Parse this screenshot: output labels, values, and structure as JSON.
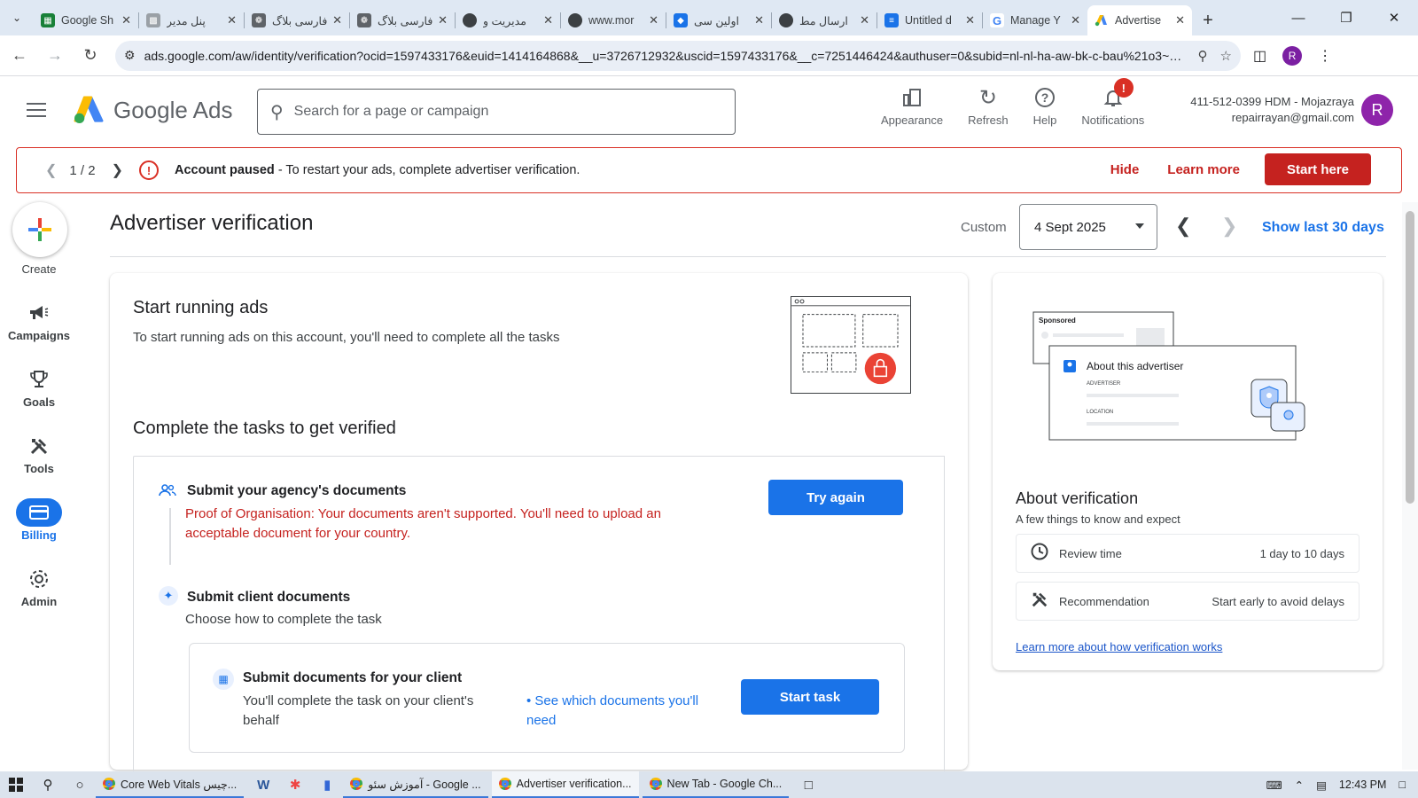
{
  "browser": {
    "tabs": [
      {
        "title": "Google Sh",
        "fav_color": "#188038",
        "fav_icon": "sheets-icon"
      },
      {
        "title": "پنل مدیر",
        "fav_color": "#9aa0a6",
        "fav_icon": "panel-icon"
      },
      {
        "title": "فارسی بلاگ",
        "fav_color": "#5f6368",
        "fav_icon": "gear-icon"
      },
      {
        "title": "فارسی بلاگ",
        "fav_color": "#5f6368",
        "fav_icon": "gear-icon"
      },
      {
        "title": "مدیریت و",
        "fav_color": "#3c4043",
        "fav_icon": "globe-icon"
      },
      {
        "title": "www.mor",
        "fav_color": "#3c4043",
        "fav_icon": "globe-icon"
      },
      {
        "title": "اولین سی",
        "fav_color": "#1a73e8",
        "fav_icon": "site-icon"
      },
      {
        "title": "ارسال مط",
        "fav_color": "#3c4043",
        "fav_icon": "globe-icon"
      },
      {
        "title": "Untitled d",
        "fav_color": "#1a73e8",
        "fav_icon": "docs-icon"
      },
      {
        "title": "Manage Y",
        "fav_color": "#4285f4",
        "fav_icon": "google-icon"
      },
      {
        "title": "Advertise",
        "fav_color": "#fbbc04",
        "fav_icon": "ads-icon",
        "active": true
      }
    ],
    "url": "ads.google.com/aw/identity/verification?ocid=1597433176&euid=1414164868&__u=3726712932&uscid=1597433176&__c=7251446424&authuser=0&subid=nl-nl-ha-aw-bk-c-bau%21o3~Cj0KCQj...",
    "profile_initial": "R"
  },
  "header": {
    "brand_google": "Google",
    "brand_ads": "Ads",
    "search_placeholder": "Search for a page or campaign",
    "tools": [
      {
        "label": "Appearance",
        "icon": "appearance-icon"
      },
      {
        "label": "Refresh",
        "icon": "refresh-icon"
      },
      {
        "label": "Help",
        "icon": "help-icon"
      },
      {
        "label": "Notifications",
        "icon": "bell-icon",
        "badge": "!"
      }
    ],
    "account_line1": "411-512-0399 HDM - Mojazraya",
    "account_line2": "repairrayan@gmail.com",
    "avatar_initial": "R"
  },
  "alert": {
    "pager": "1 / 2",
    "title": "Account paused",
    "message": " - To restart your ads, complete advertiser verification.",
    "hide": "Hide",
    "learn_more": "Learn more",
    "start": "Start here"
  },
  "nav": {
    "create": "Create",
    "items": [
      {
        "label": "Campaigns",
        "icon": "megaphone-icon"
      },
      {
        "label": "Goals",
        "icon": "trophy-icon"
      },
      {
        "label": "Tools",
        "icon": "tools-icon"
      },
      {
        "label": "Billing",
        "icon": "billing-icon",
        "selected": true
      },
      {
        "label": "Admin",
        "icon": "gear-icon"
      }
    ]
  },
  "page": {
    "title": "Advertiser verification",
    "date_label": "Custom",
    "date_value": "4 Sept 2025",
    "show_last": "Show last 30 days"
  },
  "main": {
    "heading": "Start running ads",
    "subheading": "To start running ads on this account, you'll need to complete all the tasks",
    "tasks_heading": "Complete the tasks to get verified",
    "task1": {
      "title": "Submit your agency's documents",
      "error": "Proof of Organisation: Your documents aren't supported. You'll need to upload an acceptable document for your country.",
      "button": "Try again"
    },
    "task2": {
      "title": "Submit client documents",
      "subtitle": "Choose how to complete the task",
      "option": {
        "title": "Submit documents for your client",
        "description": "You'll complete the task on your client's behalf",
        "link": "See which documents you'll need",
        "button": "Start task"
      }
    }
  },
  "side": {
    "illus_sponsored": "Sponsored",
    "illus_about": "About this advertiser",
    "illus_advertiser": "ADVERTISER",
    "illus_location": "LOCATION",
    "heading": "About verification",
    "subheading": "A few things to know and expect",
    "rows": [
      {
        "label": "Review time",
        "value": "1 day to 10 days",
        "icon": "clock-icon"
      },
      {
        "label": "Recommendation",
        "value": "Start early to avoid delays",
        "icon": "tools-icon"
      }
    ],
    "link": "Learn more about how verification works"
  },
  "taskbar": {
    "apps": [
      {
        "label": "Core Web Vitals چیس..."
      },
      {
        "label": "آموزش سئو - Google ..."
      },
      {
        "label": "Advertiser verification...",
        "active": true
      },
      {
        "label": "New Tab - Google Ch..."
      }
    ],
    "time": "12:43 PM"
  },
  "colors": {
    "primary_blue": "#1a73e8",
    "alert_red": "#c5221f",
    "billing_selected": "#1a73e8"
  }
}
